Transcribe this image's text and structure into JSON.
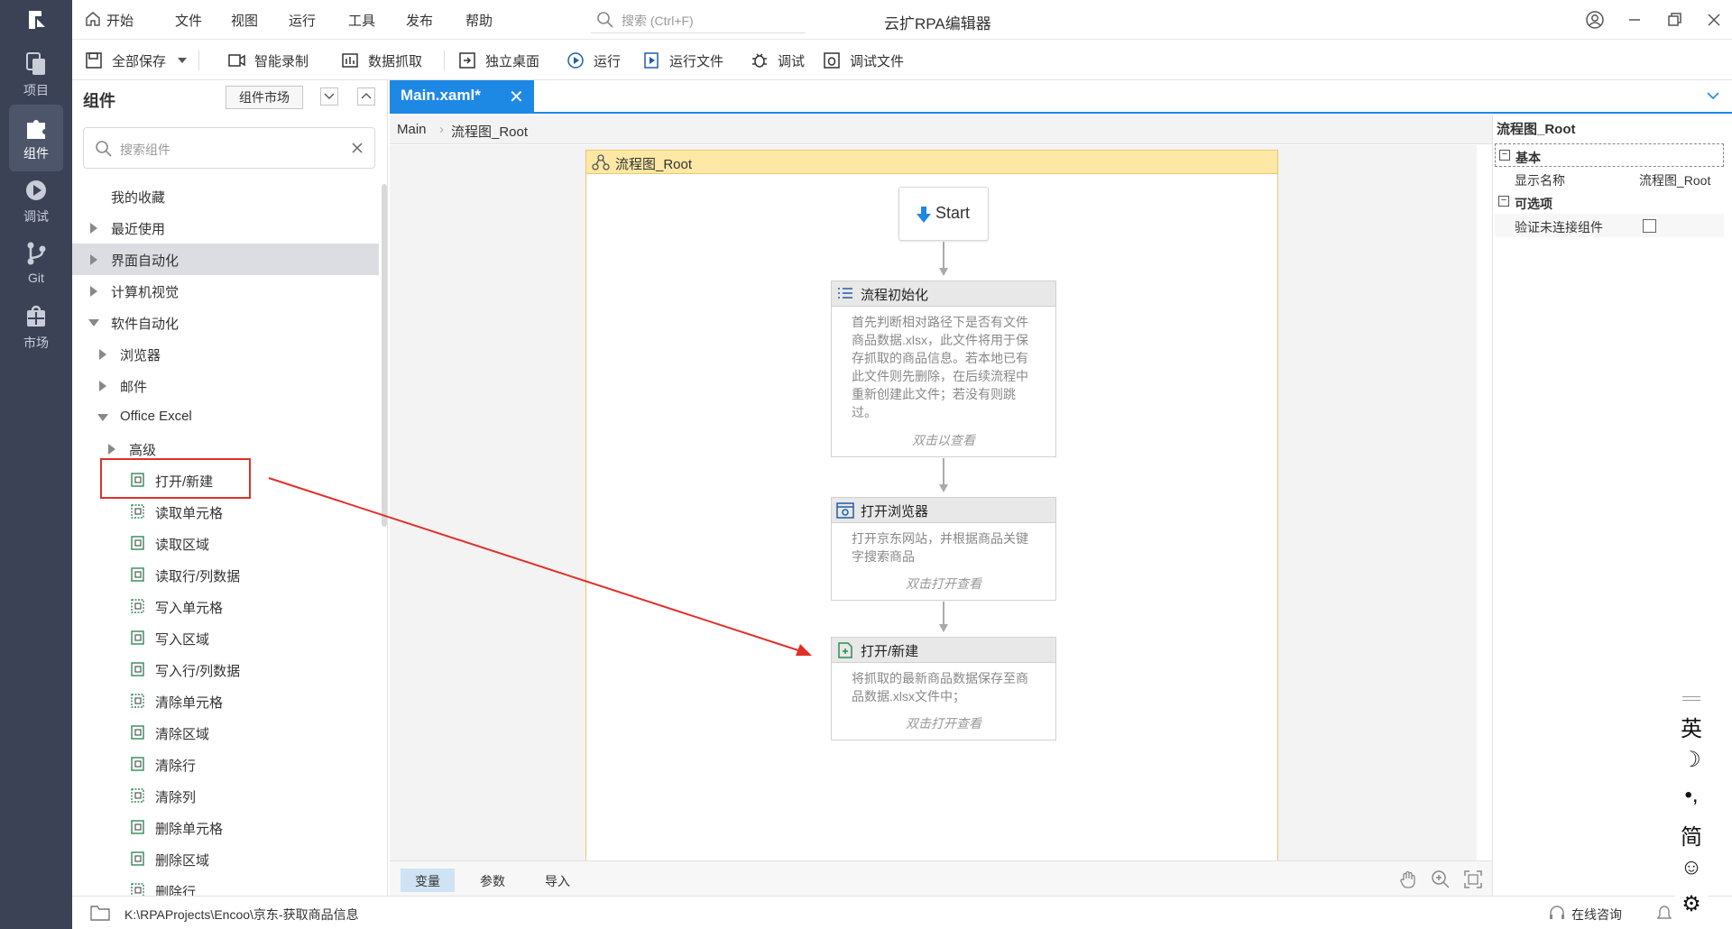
{
  "nav": {
    "items": [
      {
        "label": "项目",
        "icon": "project-icon"
      },
      {
        "label": "组件",
        "icon": "puzzle-icon"
      },
      {
        "label": "调试",
        "icon": "debug-play-icon"
      },
      {
        "label": "Git",
        "icon": "git-icon"
      },
      {
        "label": "市场",
        "icon": "market-icon"
      }
    ]
  },
  "menu": {
    "home": "开始",
    "file": "文件",
    "view": "视图",
    "run": "运行",
    "tools": "工具",
    "publish": "发布",
    "help": "帮助",
    "search_placeholder": "搜索 (Ctrl+F)"
  },
  "app_title": "云扩RPA编辑器",
  "toolbar": {
    "save_all": "全部保存",
    "smart_record": "智能录制",
    "data_scrape": "数据抓取",
    "standalone_desktop": "独立桌面",
    "run": "运行",
    "run_file": "运行文件",
    "debug": "调试",
    "debug_file": "调试文件"
  },
  "components": {
    "title": "组件",
    "market_button": "组件市场",
    "search_placeholder": "搜索组件",
    "tree": {
      "favorites": "我的收藏",
      "recent": "最近使用",
      "ui_automation": "界面自动化",
      "computer_vision": "计算机视觉",
      "software_automation": "软件自动化",
      "browser": "浏览器",
      "mail": "邮件",
      "office_excel": "Office Excel",
      "advanced": "高级",
      "excel_items": [
        "打开/新建",
        "读取单元格",
        "读取区域",
        "读取行/列数据",
        "写入单元格",
        "写入区域",
        "写入行/列数据",
        "清除单元格",
        "清除区域",
        "清除行",
        "清除列",
        "删除单元格",
        "删除区域",
        "删除行"
      ]
    }
  },
  "editor": {
    "tab_label": "Main.xaml*",
    "breadcrumb": [
      "Main",
      "流程图_Root"
    ],
    "flowchart_title": "流程图_Root",
    "start_label": "Start",
    "activities": [
      {
        "title": "流程初始化",
        "desc": "首先判断相对路径下是否有文件 商品数据.xlsx，此文件将用于保存抓取的商品信息。若本地已有此文件则先删除，在后续流程中重新创建此文件；若没有则跳过。",
        "hint": "双击以查看"
      },
      {
        "title": "打开浏览器",
        "desc": "打开京东网站，并根据商品关键字搜索商品",
        "hint": "双击打开查看"
      },
      {
        "title": "打开/新建",
        "desc": "将抓取的最新商品数据保存至商品数据.xlsx文件中；",
        "hint": "双击打开查看"
      }
    ],
    "bottom_tabs": [
      "变量",
      "参数",
      "导入"
    ]
  },
  "properties": {
    "title": "流程图_Root",
    "cat_basic": "基本",
    "display_name_label": "显示名称",
    "display_name_value": "流程图_Root",
    "cat_optional": "可选项",
    "validate_label": "验证未连接组件"
  },
  "status": {
    "path": "K:\\RPAProjects\\Encoo\\京东-获取商品信息",
    "consult": "在线咨询"
  },
  "ime": {
    "items": [
      "英",
      "☽",
      "•,",
      "简",
      "☺",
      "⚙"
    ]
  },
  "colors": {
    "accent": "#1e88e5",
    "nav_bg": "#3b4256",
    "flow_header": "#fde8a5",
    "annotation_red": "#e0302a"
  }
}
